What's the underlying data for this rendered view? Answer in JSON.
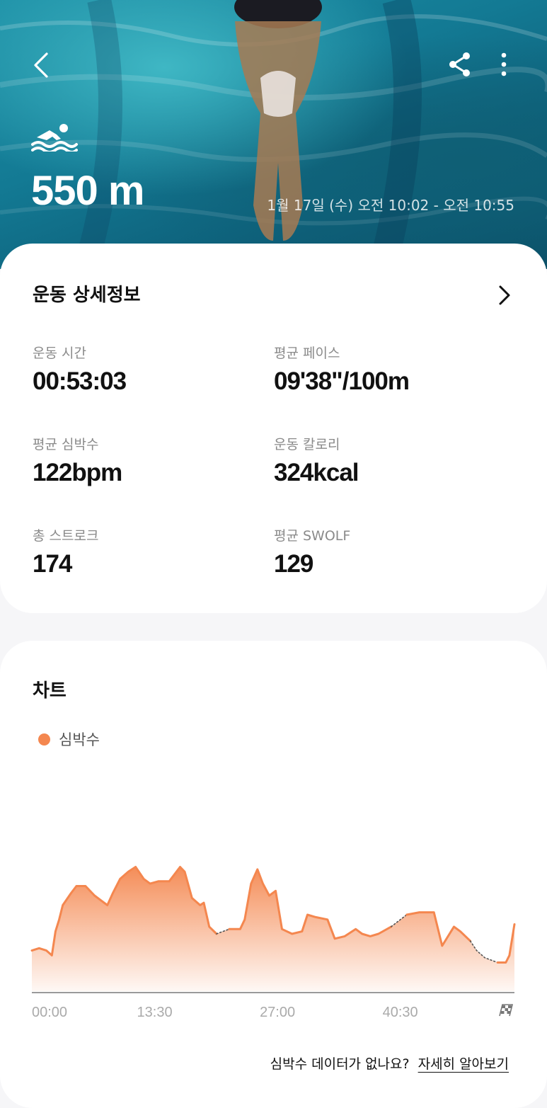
{
  "hero": {
    "distance": "550 m",
    "date_range": "1월 17일 (수) 오전 10:02 - 오전 10:55",
    "icons": {
      "back": "back-arrow-icon",
      "share": "share-icon",
      "more": "more-vertical-icon",
      "activity": "swimming-icon"
    }
  },
  "details": {
    "title": "운동 상세정보",
    "stats": [
      {
        "label": "운동 시간",
        "value": "00:53:03"
      },
      {
        "label": "평균 페이스",
        "value": "09'38\"/100m"
      },
      {
        "label": "평균 심박수",
        "value": "122bpm"
      },
      {
        "label": "운동 칼로리",
        "value": "324kcal"
      },
      {
        "label": "총 스트로크",
        "value": "174"
      },
      {
        "label": "평균 SWOLF",
        "value": "129"
      }
    ]
  },
  "chart": {
    "title": "차트",
    "legend": "심박수",
    "finish_icon": "checkered-flag-icon"
  },
  "chart_data": {
    "type": "area",
    "xlabel": "",
    "ylabel": "",
    "x_ticks": [
      "00:00",
      "13:30",
      "27:00",
      "40:30"
    ],
    "x_tick_minutes": [
      0,
      13.5,
      27,
      40.5
    ],
    "xlim": [
      0,
      53.05
    ],
    "color": "#f4874f",
    "series": [
      {
        "name": "심박수",
        "x": [
          0,
          0.8,
          1.6,
          2.2,
          2.6,
          3,
          3.4,
          4.3,
          4.9,
          5.9,
          6.9,
          8.3,
          8.9,
          9.7,
          10.6,
          11.4,
          12.3,
          13,
          13.9,
          15.1,
          16.3,
          16.8,
          17.6,
          18.5,
          18.9,
          19.5,
          20.3,
          21.7,
          22.9,
          23.4,
          24.1,
          24.8,
          25.4,
          26.1,
          26.8,
          27.5,
          28.6,
          29.7,
          30.3,
          31.2,
          32.5,
          33.3,
          34.4,
          35.6,
          36.3,
          37.2,
          38.1,
          39.5,
          41.2,
          42.6,
          44.2,
          45.1,
          46.4,
          47.1,
          48.2,
          48.9,
          49.8,
          51.2,
          52.1,
          52.5,
          53.05
        ],
        "y": [
          87,
          88,
          87,
          85,
          95,
          100,
          106,
          111,
          114,
          114,
          110,
          106,
          111,
          117,
          120,
          122,
          117,
          115,
          116,
          116,
          122,
          120,
          109,
          106,
          107,
          97,
          94,
          96,
          96,
          100,
          115,
          121,
          115,
          110,
          112,
          96,
          94,
          95,
          102,
          101,
          100,
          92,
          93,
          96,
          94,
          93,
          94,
          97,
          102,
          103,
          103,
          89,
          97,
          95,
          91,
          87,
          84,
          82,
          82,
          85,
          98
        ]
      }
    ],
    "segments": [
      {
        "from": 0,
        "to": 20.3,
        "style": "solid"
      },
      {
        "from": 20.3,
        "to": 21.7,
        "style": "dashed"
      },
      {
        "from": 21.7,
        "to": 39.5,
        "style": "solid"
      },
      {
        "from": 39.5,
        "to": 41.2,
        "style": "dashed"
      },
      {
        "from": 41.2,
        "to": 48.2,
        "style": "solid"
      },
      {
        "from": 48.2,
        "to": 51.2,
        "style": "dashed"
      },
      {
        "from": 51.2,
        "to": 53.05,
        "style": "solid"
      }
    ],
    "ylim": [
      70,
      150
    ]
  },
  "footer": {
    "question": "심박수 데이터가 없나요?",
    "link": "자세히 알아보기"
  }
}
